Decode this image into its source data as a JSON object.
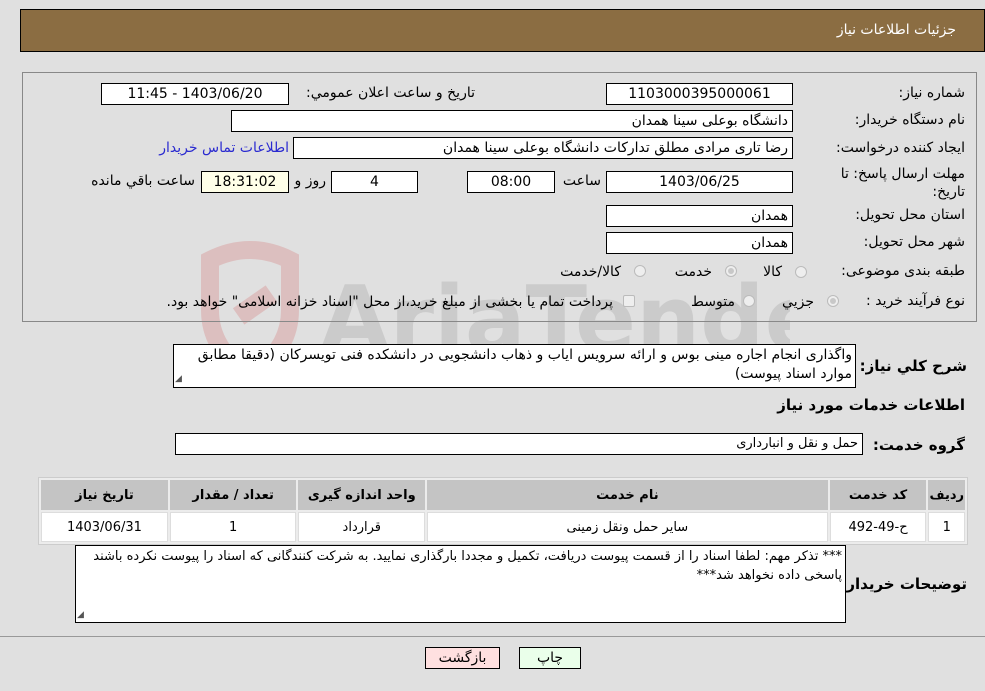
{
  "header": {
    "title": "جزئیات اطلاعات نیاز"
  },
  "form": {
    "need_number": {
      "label": "شماره نیاز:",
      "value": "1103000395000061"
    },
    "announce_datetime": {
      "label": "تاریخ و ساعت اعلان عمومي:",
      "value": "1403/06/20 - 11:45"
    },
    "buyer_org": {
      "label": "نام دستگاه خريدار:",
      "value": "دانشگاه بوعلی سینا همدان"
    },
    "requester": {
      "label": "ایجاد کننده درخواست:",
      "value": "رضا تاری مرادی مطلق تدارکات دانشگاه بوعلی سینا همدان"
    },
    "buyer_contact_link": "اطلاعات تماس خريدار",
    "deadline": {
      "label": "مهلت ارسال پاسخ: تا تاریخ:",
      "date": "1403/06/25",
      "time_label": "ساعت",
      "time": "08:00",
      "days": "4",
      "days_label": "روز و",
      "remaining": "18:31:02",
      "remaining_label": "ساعت باقي مانده"
    },
    "province": {
      "label": "استان محل تحویل:",
      "value": "همدان"
    },
    "city": {
      "label": "شهر محل تحویل:",
      "value": "همدان"
    },
    "category": {
      "label": "طبقه بندی موضوعی:",
      "options": [
        "کالا",
        "خدمت",
        "کالا/خدمت"
      ],
      "selected": "خدمت"
    },
    "purchase_type": {
      "label": "نوع فرآیند خرید :",
      "options": [
        "جزيي",
        "متوسط"
      ],
      "selected": "جزيي",
      "treasury_note": "پرداخت تمام یا بخشی از مبلغ خرید،از محل \"اسناد خزانه اسلامی\" خواهد بود."
    }
  },
  "description": {
    "label": "شرح کلي نياز:",
    "value": "واگذاری انجام اجاره مینی بوس و ارائه سرویس ایاب و ذهاب دانشجویی در دانشکده فنی تویسرکان (دقیقا مطابق موارد اسناد پیوست)"
  },
  "services_section": {
    "title": "اطلاعات خدمات مورد نياز",
    "group_label": "گروه خدمت:",
    "group_value": "حمل و نقل و انبارداری",
    "table": {
      "headers": [
        "رديف",
        "کد خدمت",
        "نام خدمت",
        "واحد اندازه گيری",
        "تعداد / مقدار",
        "تاريخ نياز"
      ],
      "rows": [
        [
          "1",
          "ح-49-492",
          "سایر حمل ونقل زمینی",
          "قرارداد",
          "1",
          "1403/06/31"
        ]
      ]
    }
  },
  "buyer_notes": {
    "label": "توضيحات خريدار:",
    "value": "*** تذکر مهم: لطفا اسناد را از قسمت پیوست دریافت، تکمیل و مجددا بارگذاری نمایید. به شرکت کنندگانی که اسناد را پیوست نکرده باشند پاسخی داده نخواهد شد***"
  },
  "buttons": {
    "print": "چاپ",
    "back": "بازگشت"
  },
  "watermark": {
    "text": "AriaTender.neT"
  },
  "colors": {
    "header_bg": "#8b6d42",
    "print_bg": "#eaffea",
    "back_bg": "#ffe0e0",
    "remaining_bg": "#ffffe8",
    "link": "#2a2ad0"
  }
}
